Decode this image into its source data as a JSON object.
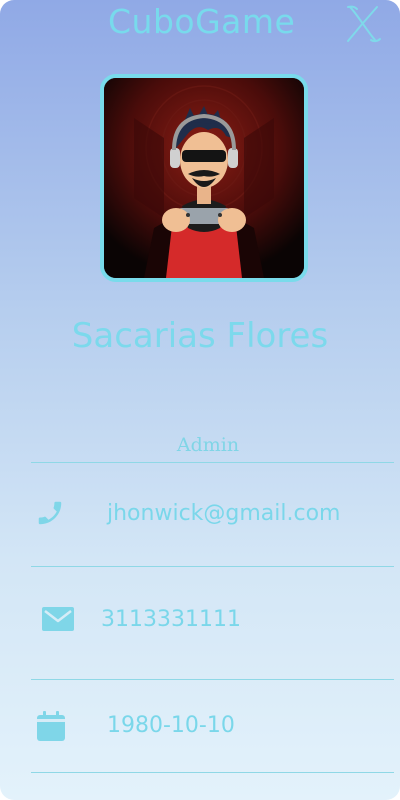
{
  "header": {
    "brand": "CuboGame",
    "close_icon": "close-icon"
  },
  "profile": {
    "avatar": "gamer-avatar-image",
    "name": "Sacarias Flores",
    "role": "Admin"
  },
  "contact": {
    "email": {
      "icon": "phone-icon",
      "value": "jhonwick@gmail.com"
    },
    "phone": {
      "icon": "envelope-icon",
      "value": "3113331111"
    },
    "birthdate": {
      "icon": "calendar-icon",
      "value": "1980-10-10"
    }
  },
  "colors": {
    "accent": "#79dbeb",
    "gradient_top": "#90a9e6",
    "gradient_bottom": "#e3f2fb"
  }
}
